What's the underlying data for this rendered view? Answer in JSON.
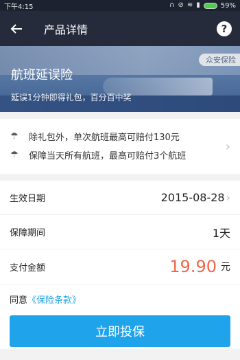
{
  "status_bar": {
    "time": "下午4:15",
    "battery_text": "59%"
  },
  "header": {
    "title": "产品详情"
  },
  "banner": {
    "title": "航班延误险",
    "subtitle": "延误1分钟即得礼包，百分百中奖",
    "provider": "众安保险"
  },
  "features": [
    {
      "text": "除礼包外，单次航班最高可赔付130元"
    },
    {
      "text": "保障当天所有航班，最高可赔付3个航班"
    }
  ],
  "details": {
    "effective_date": {
      "label": "生效日期",
      "value": "2015-08-28"
    },
    "coverage_period": {
      "label": "保障期间",
      "value": "1天"
    },
    "payment": {
      "label": "支付金额",
      "value": "19.90",
      "unit": "元"
    }
  },
  "agreement": {
    "prefix": "同意",
    "link": "《保险条款》"
  },
  "submit": {
    "label": "立即投保"
  },
  "colors": {
    "accent": "#1fa3ea",
    "price": "#f2664a",
    "header_bg": "#262b3b"
  }
}
